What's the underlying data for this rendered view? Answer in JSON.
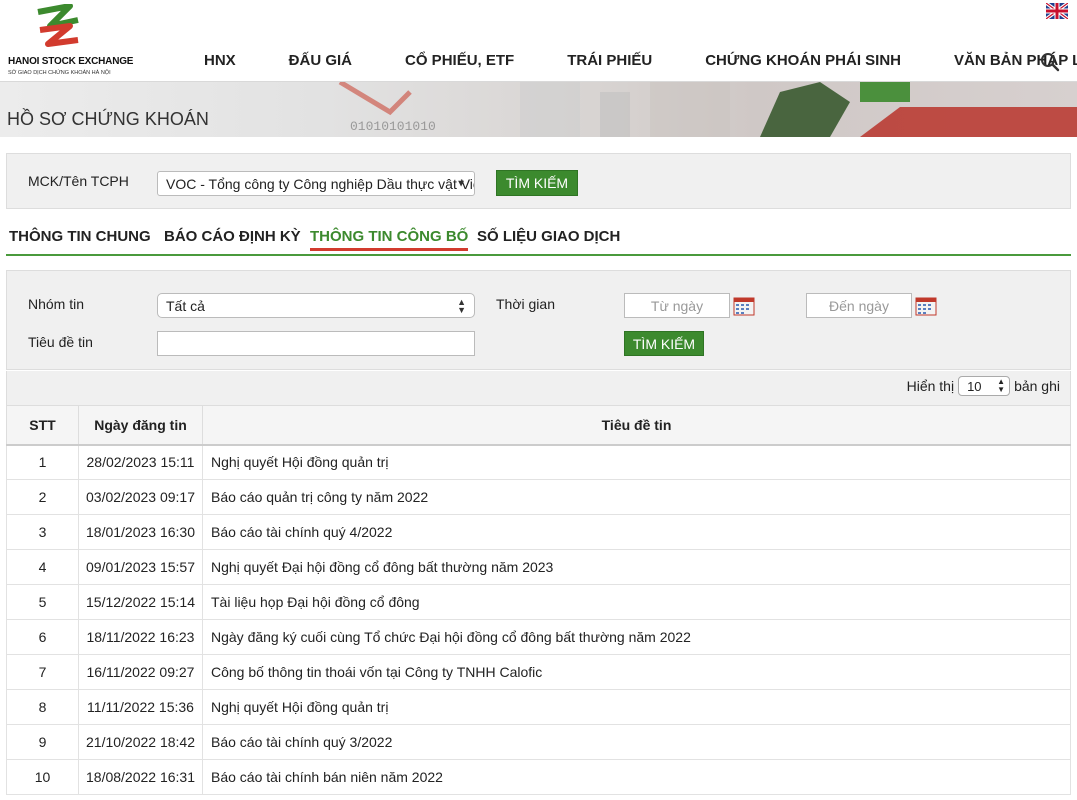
{
  "header": {
    "logo_title": "HANOI STOCK EXCHANGE",
    "logo_sub": "SỞ GIAO DỊCH CHỨNG KHOÁN HÀ NỘI",
    "nav": [
      "HNX",
      "ĐẤU GIÁ",
      "CỔ PHIẾU, ETF",
      "TRÁI PHIẾU",
      "CHỨNG KHOÁN PHÁI SINH",
      "VĂN BẢN PHÁP LÝ"
    ],
    "icons": {
      "language": "uk-flag-icon",
      "search": "search-icon"
    }
  },
  "banner": {
    "title": "HỒ SƠ CHỨNG KHOÁN"
  },
  "stock_search": {
    "label": "MCK/Tên TCPH",
    "value": "VOC - Tổng công ty Công nghiệp Dầu thực vật Việt N...",
    "button": "TÌM KIẾM"
  },
  "tabs": {
    "items": [
      "THÔNG TIN CHUNG",
      "BÁO CÁO ĐỊNH KỲ",
      "THÔNG TIN CÔNG BỐ",
      "SỐ LIỆU GIAO DỊCH"
    ],
    "active": "THÔNG TIN CÔNG BỐ"
  },
  "filter": {
    "group_label": "Nhóm tin",
    "group_value": "Tất cả",
    "time_label": "Thời gian",
    "from_placeholder": "Từ ngày",
    "to_placeholder": "Đến ngày",
    "title_label": "Tiêu đề tin",
    "title_value": "",
    "button": "TÌM KIẾM"
  },
  "pagination": {
    "show_label": "Hiển thị",
    "page_size": "10",
    "records_label": "bản ghi"
  },
  "table": {
    "columns": [
      "STT",
      "Ngày đăng tin",
      "Tiêu đề tin"
    ],
    "rows": [
      [
        "1",
        "28/02/2023 15:11",
        "Nghị quyết Hội đồng quản trị"
      ],
      [
        "2",
        "03/02/2023 09:17",
        "Báo cáo quản trị công ty năm 2022"
      ],
      [
        "3",
        "18/01/2023 16:30",
        "Báo cáo tài chính quý 4/2022"
      ],
      [
        "4",
        "09/01/2023 15:57",
        "Nghị quyết Đại hội đồng cổ đông bất thường năm 2023"
      ],
      [
        "5",
        "15/12/2022 15:14",
        "Tài liệu họp Đại hội đồng cổ đông"
      ],
      [
        "6",
        "18/11/2022 16:23",
        "Ngày đăng ký cuối cùng Tổ chức Đại hội đồng cổ đông bất thường năm 2022"
      ],
      [
        "7",
        "16/11/2022 09:27",
        "Công bố thông tin thoái vốn tại Công ty TNHH Calofic"
      ],
      [
        "8",
        "11/11/2022 15:36",
        "Nghị quyết Hội đồng quản trị"
      ],
      [
        "9",
        "21/10/2022 18:42",
        "Báo cáo tài chính quý 3/2022"
      ],
      [
        "10",
        "18/08/2022 16:31",
        "Báo cáo tài chính bán niên năm 2022"
      ]
    ]
  },
  "colors": {
    "accent_green": "#3c8a2e",
    "active_underline": "#d23b2e"
  }
}
